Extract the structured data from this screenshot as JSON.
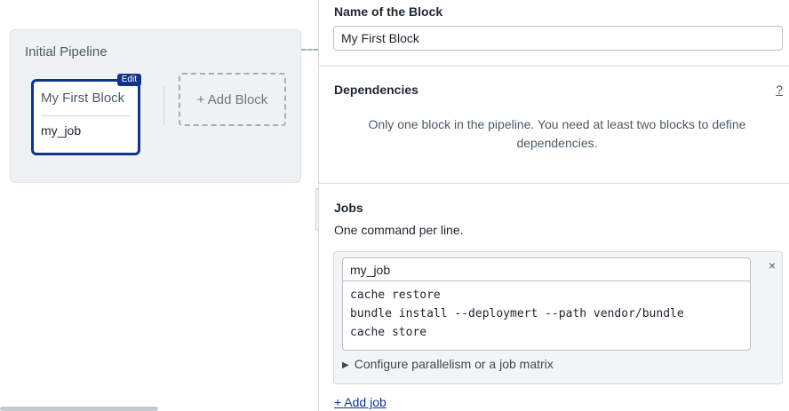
{
  "canvas": {
    "pipeline_title": "Initial Pipeline",
    "block": {
      "edit_badge": "Edit",
      "name": "My First Block",
      "job": "my_job"
    },
    "add_block_label": "+ Add Block"
  },
  "editor": {
    "name_section": {
      "label": "Name of the Block",
      "value": "My First Block"
    },
    "dependencies": {
      "label": "Dependencies",
      "help": "?",
      "message": "Only one block in the pipeline. You need at least two blocks to define dependencies."
    },
    "jobs": {
      "label": "Jobs",
      "subtitle": "One command per line.",
      "items": [
        {
          "name": "my_job",
          "commands": "cache restore\nbundle install --deploymert --path vendor/bundle\ncache store",
          "close_symbol": "×",
          "parallelism_label": "Configure parallelism or a job matrix"
        }
      ],
      "add_job_label": "+ Add job"
    }
  },
  "colors": {
    "accent": "#11338a",
    "panel_bg": "#eff2f3",
    "border": "#d5dadd"
  }
}
